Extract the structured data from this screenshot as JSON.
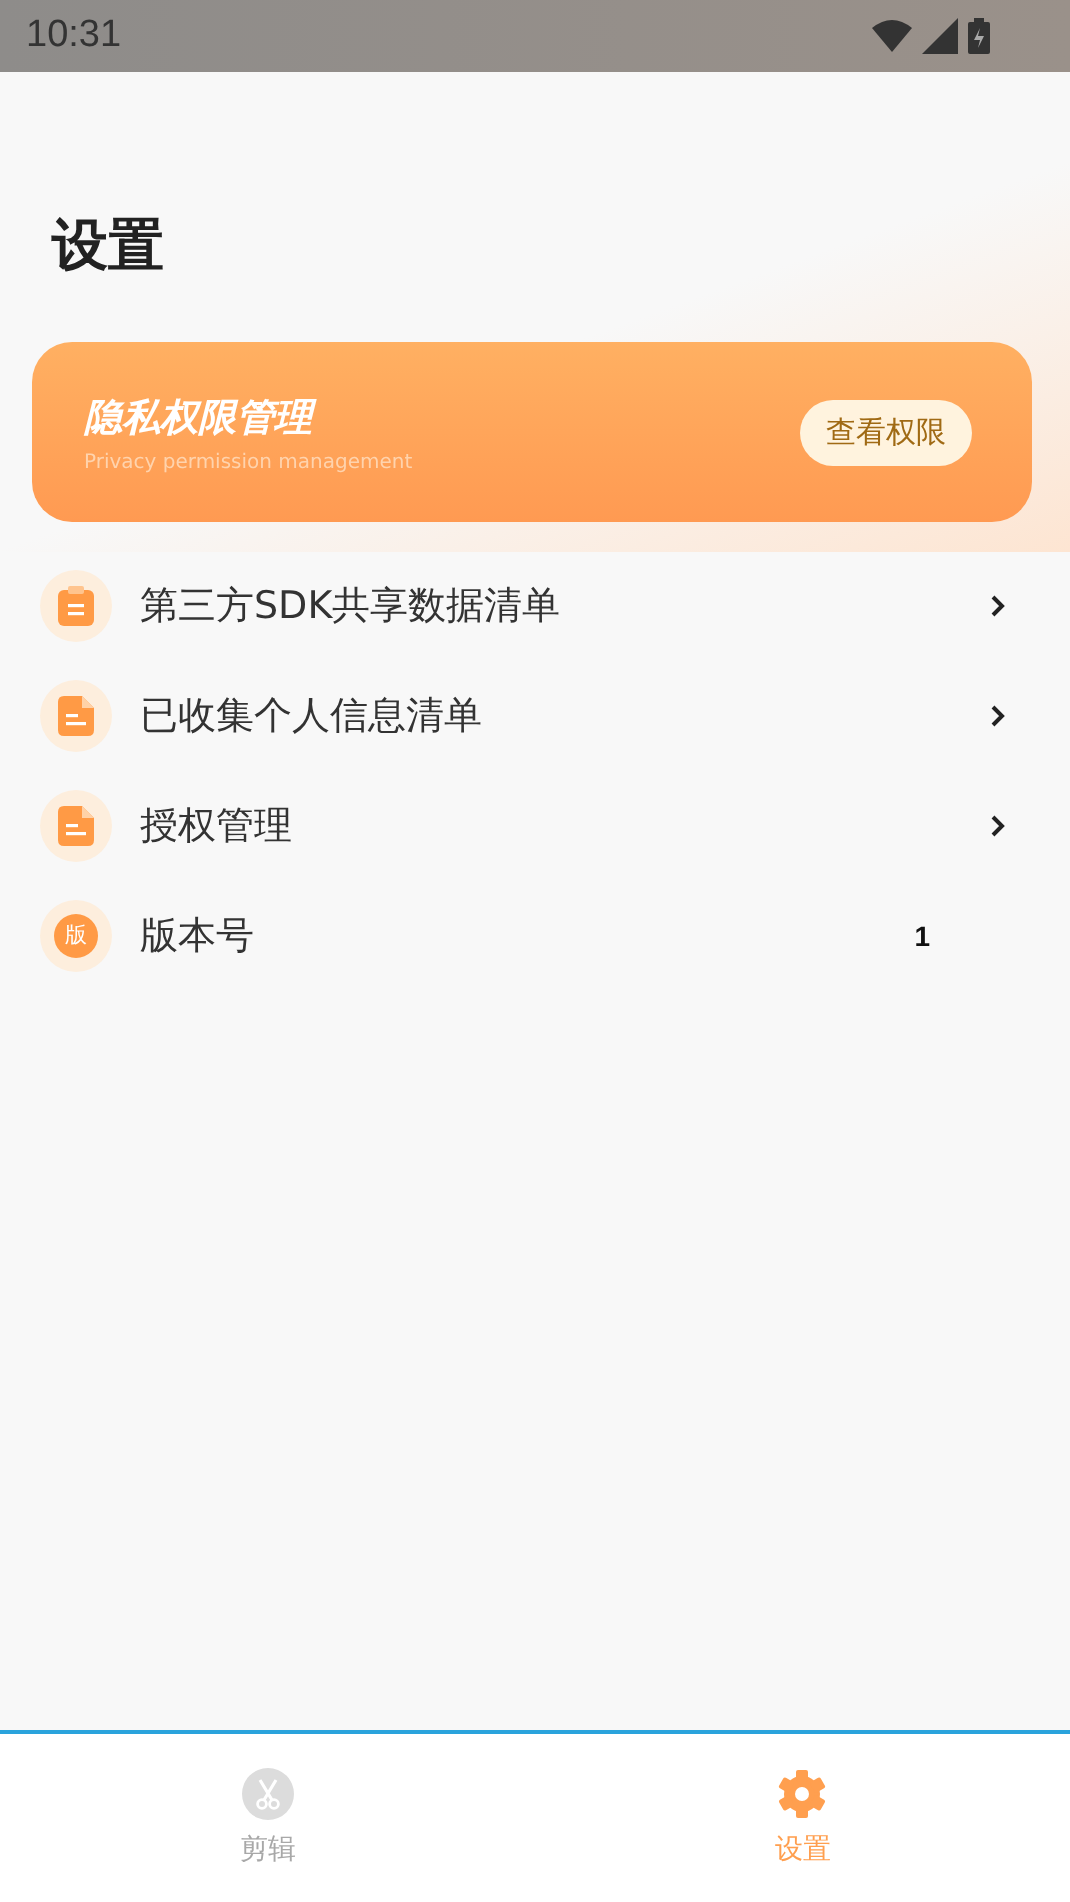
{
  "status_bar": {
    "time": "10:31"
  },
  "title": "设置",
  "banner": {
    "title": "隐私权限管理",
    "subtitle": "Privacy permission management",
    "button": "查看权限"
  },
  "items": [
    {
      "label": "第三方SDK共享数据清单",
      "kind": "link"
    },
    {
      "label": "已收集个人信息清单",
      "kind": "link"
    },
    {
      "label": "授权管理",
      "kind": "link"
    },
    {
      "label": "版本号",
      "icon_text": "版",
      "kind": "value",
      "value": "1"
    }
  ],
  "tabs": [
    {
      "label": "剪辑",
      "selected": false
    },
    {
      "label": "设置",
      "selected": true
    }
  ]
}
